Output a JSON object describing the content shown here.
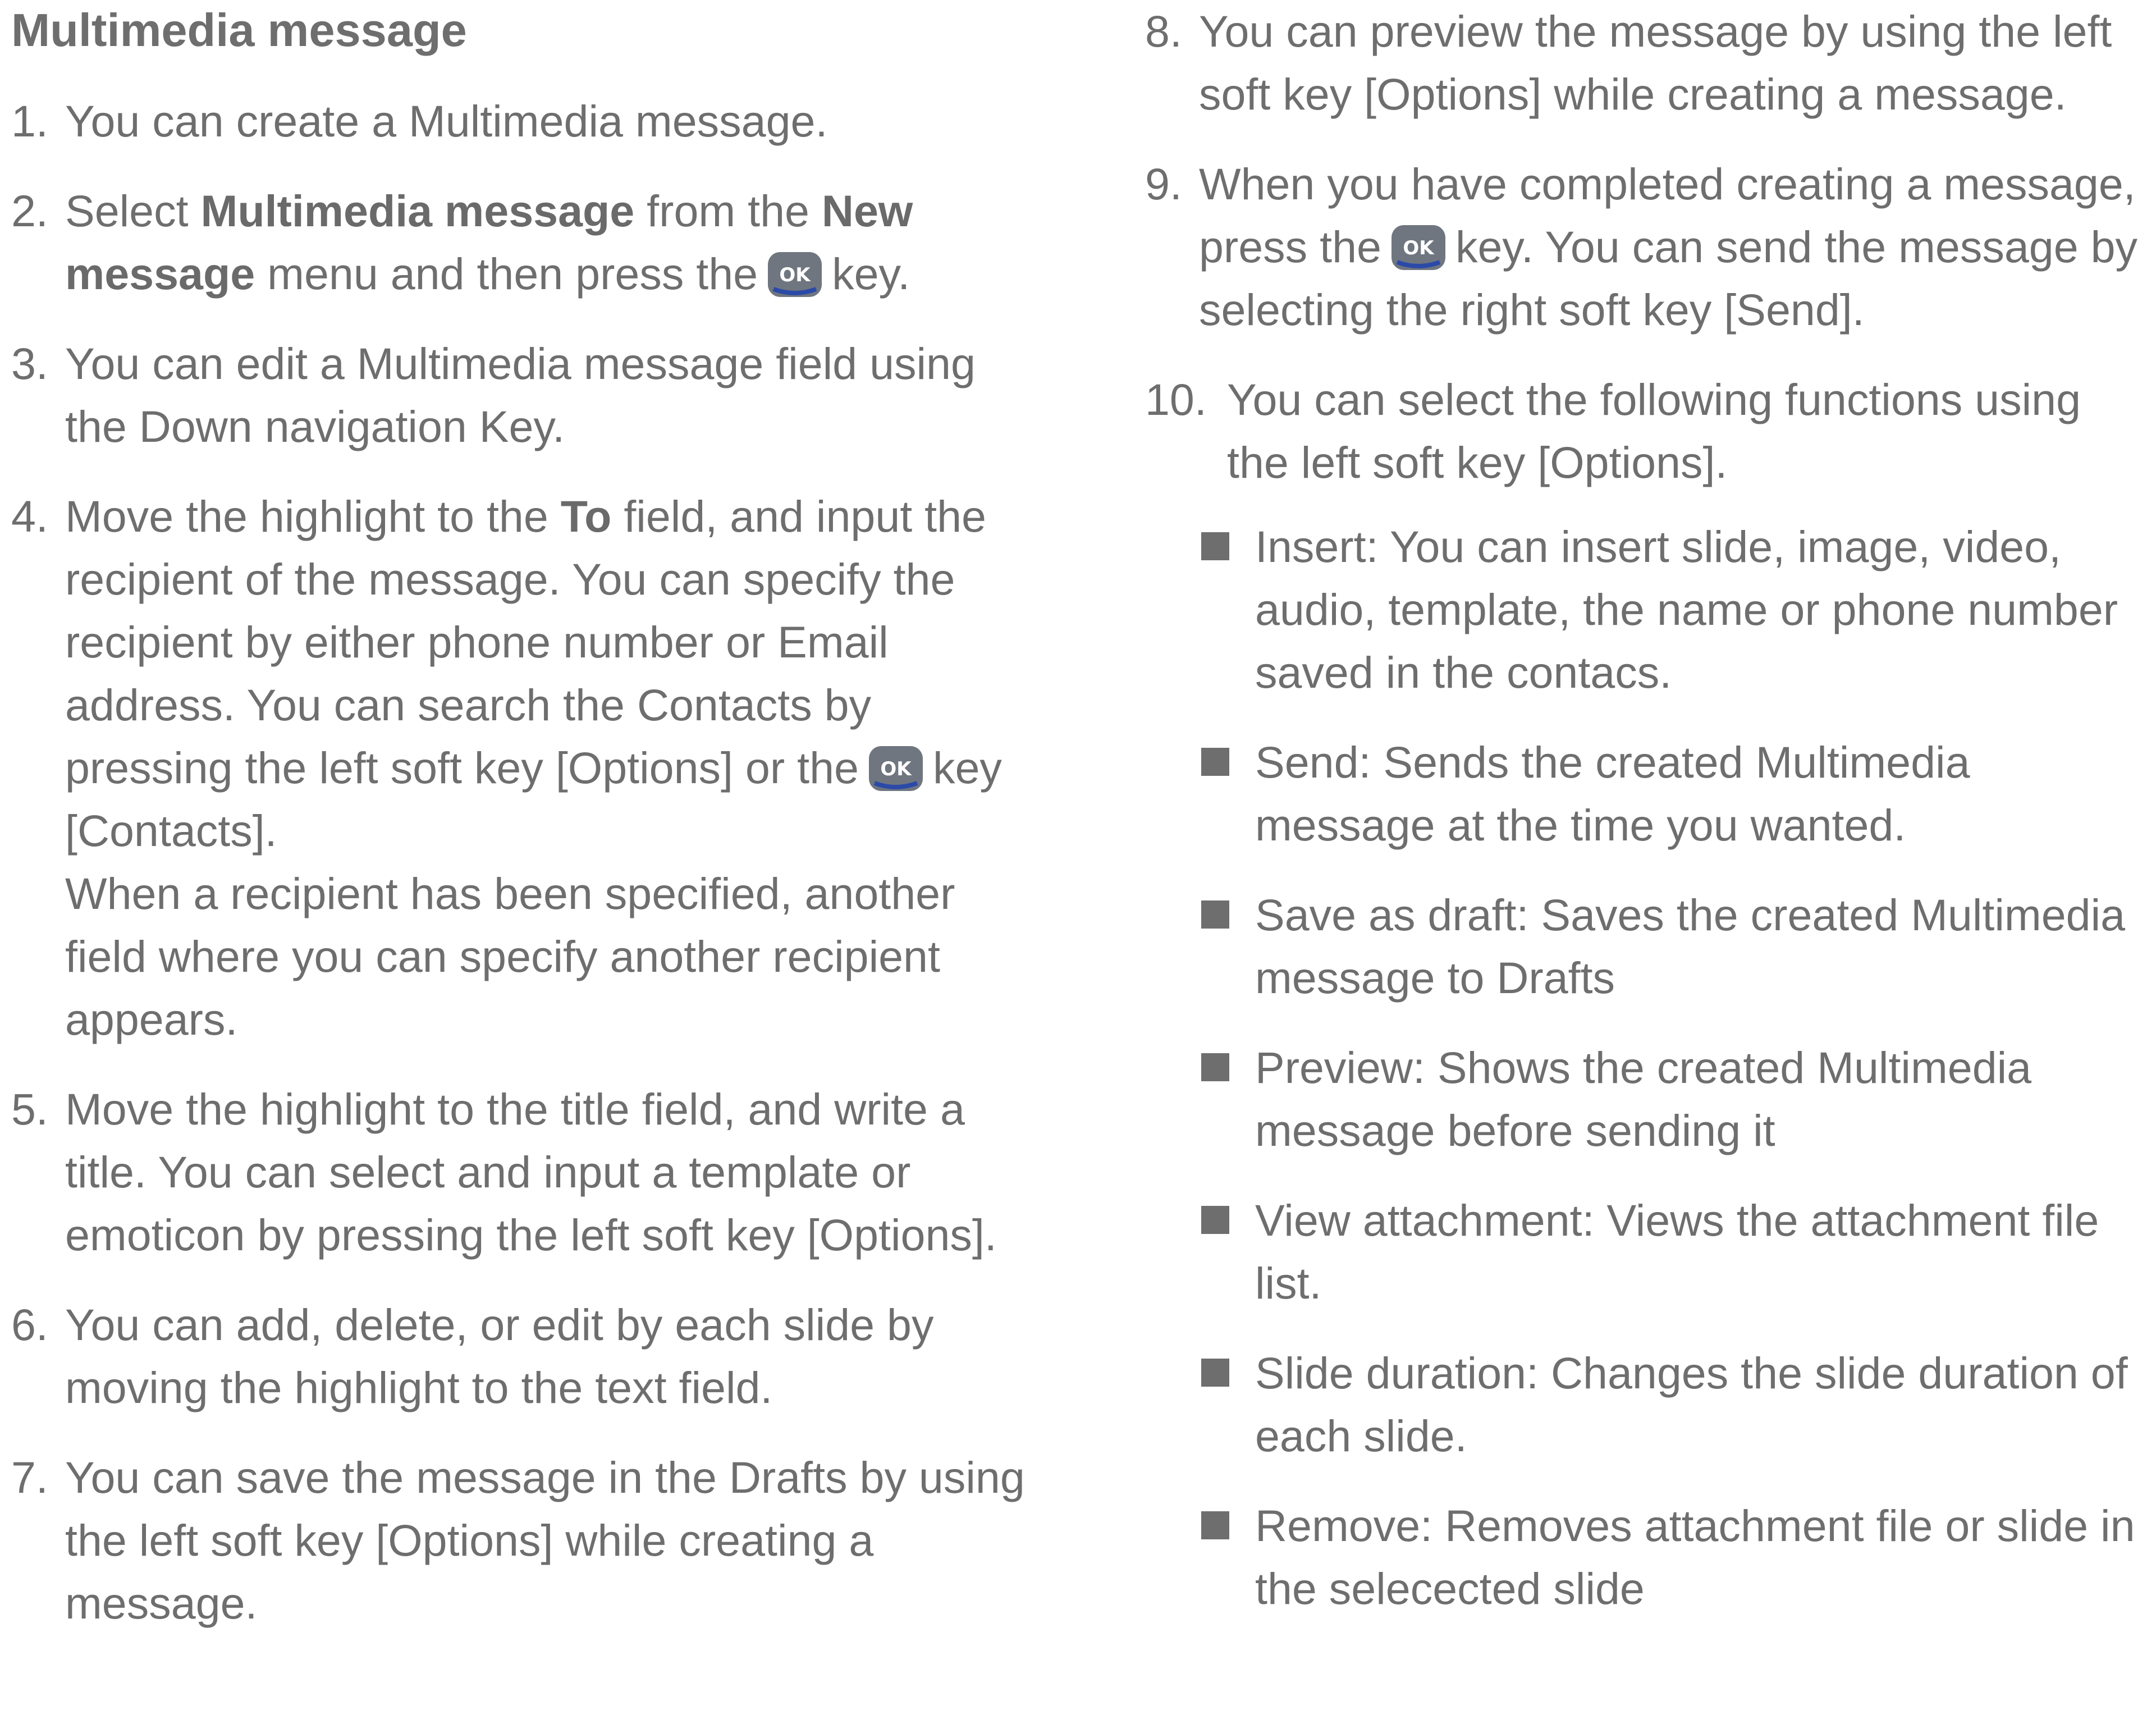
{
  "title": "Multimedia message",
  "colors": {
    "text": "#6e6e6e",
    "ok_key_body": "#6f7680",
    "ok_key_accent": "#2b4aa8"
  },
  "icons": {
    "ok_key": "ok-key-icon",
    "bullet": "square-bullet-icon"
  },
  "steps": {
    "s1": {
      "num": "1.",
      "text": "You can create a Multimedia message."
    },
    "s2": {
      "num": "2.",
      "pre": "Select ",
      "b1": "Multimedia message",
      "mid": " from the ",
      "b2": "New message",
      "post": " menu and then press the",
      "end": "key."
    },
    "s3": {
      "num": "3.",
      "text": "You can edit a Multimedia message field using the Down navigation Key."
    },
    "s4": {
      "num": "4.",
      "pre": "Move the highlight to the ",
      "b1": "To",
      "mid": " field, and input the recipient of the message. You can specify the recipient by either phone number or Email address. You can search the Contacts by pressing the left soft key [Options] or the",
      "post": "key [Contacts].",
      "extra": "When a recipient has been specified, another field where you can specify another recipient appears."
    },
    "s5": {
      "num": "5.",
      "text": "Move the highlight to the title field, and write a title. You can select and input a template or emoticon by pressing the left soft key [Options]."
    },
    "s6": {
      "num": "6.",
      "text": "You can add, delete, or edit by each slide by moving the highlight to the text field."
    },
    "s7": {
      "num": "7.",
      "text": "You can save the message in the Drafts by using the left soft key [Options] while creating a message."
    },
    "s8": {
      "num": "8.",
      "text": "You can preview the message by using the left soft key [Options] while creating a message."
    },
    "s9": {
      "num": "9.",
      "pre": "When you have completed creating a message, press the",
      "post": "key. You can send the message by selecting the right soft key [Send]."
    },
    "s10": {
      "num": "10.",
      "text": "You can select the following functions using the left soft key [Options]."
    }
  },
  "bullets": {
    "insert": "Insert: You can insert slide, image, video, audio, template, the name or phone number saved in the contacs.",
    "send": "Send: Sends the created Multimedia message at the time you wanted.",
    "save_draft": "Save as draft: Saves the created Multimedia message to Drafts",
    "preview": "Preview: Shows the created Multimedia message before sending it",
    "view_attachment": "View attachment: Views the attachment file list.",
    "slide_duration": "Slide duration: Changes the slide duration of each slide.",
    "remove": "Remove: Removes attachment file or slide in the selecected slide"
  }
}
